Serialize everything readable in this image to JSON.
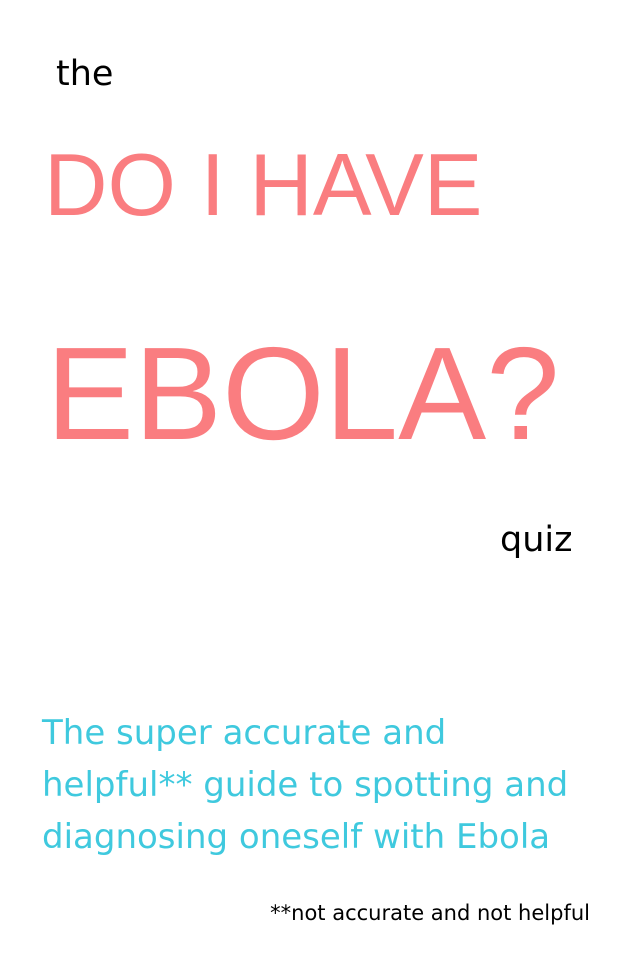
{
  "cover": {
    "the": "the",
    "title_line_1": "DO I HAVE",
    "title_line_2": "EBOLA?",
    "quiz": "quiz",
    "subtitle": "The super accurate and\nhelpful** guide to spotting and\ndiagnosing oneself with Ebola",
    "footnote": "**not accurate and not helpful"
  },
  "colors": {
    "title": "#fa7d80",
    "subtitle": "#3fc9de",
    "text": "#000000",
    "background": "#ffffff"
  }
}
